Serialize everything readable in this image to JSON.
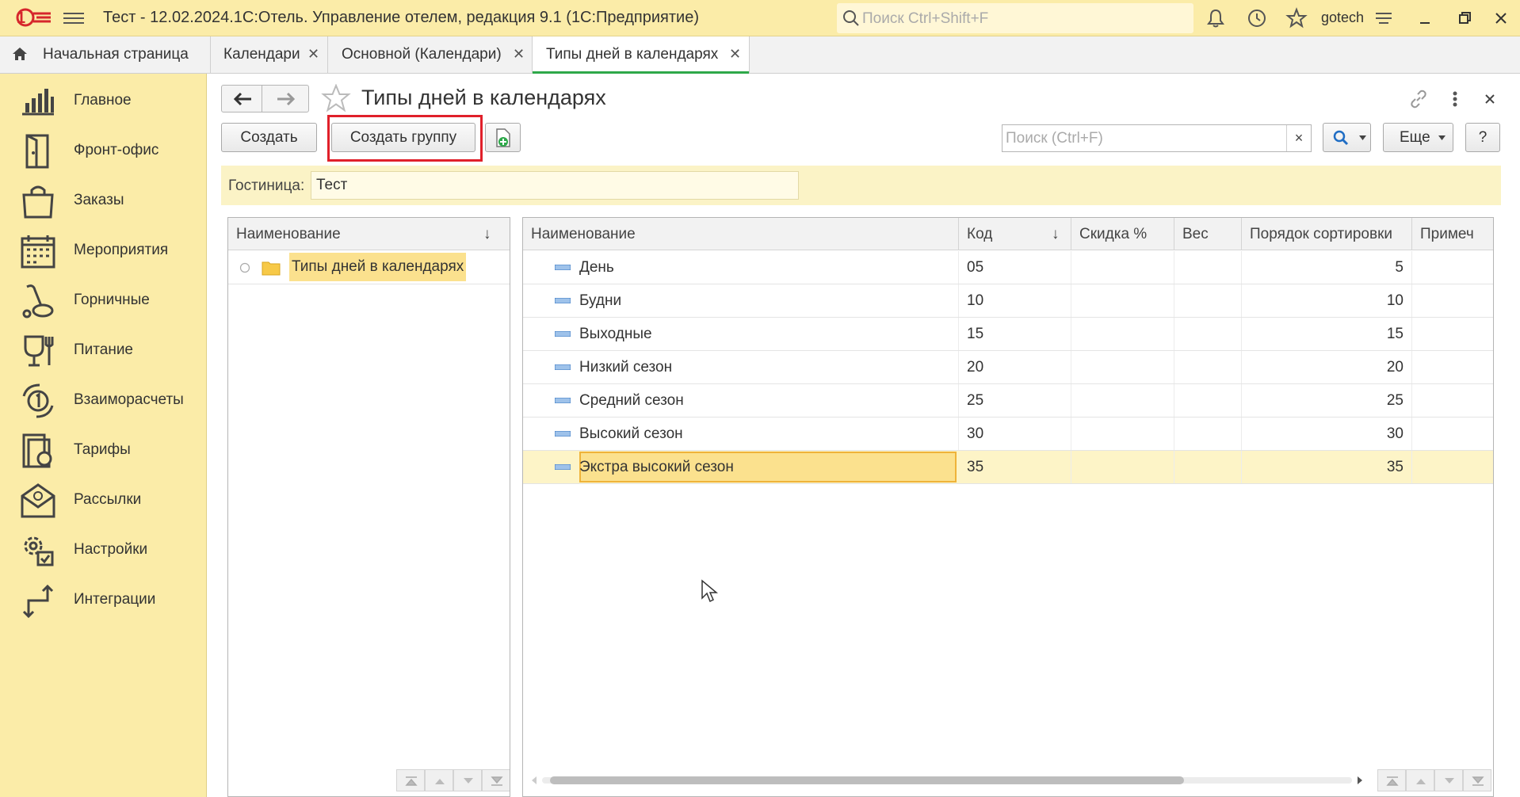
{
  "app": {
    "logo": "1С",
    "window_title": "Тест - 12.02.2024.1С:Отель. Управление отелем, редакция 9.1  (1С:Предприятие)",
    "search_placeholder": "Поиск Ctrl+Shift+F",
    "user": "gotech",
    "icons": [
      "menu-icon",
      "bell-icon",
      "history-icon",
      "star-icon",
      "settings-lines-icon",
      "minimize-icon",
      "restore-icon",
      "close-icon"
    ]
  },
  "tabs": [
    {
      "label": "Начальная страница",
      "icon": "home-icon",
      "closable": false,
      "active": false
    },
    {
      "label": "Календари",
      "closable": true,
      "active": false
    },
    {
      "label": "Основной (Календари)",
      "closable": true,
      "active": false
    },
    {
      "label": "Типы дней в календарях",
      "closable": true,
      "active": true
    }
  ],
  "sidebar": {
    "items": [
      {
        "label": "Главное",
        "icon": "chart-bars-icon"
      },
      {
        "label": "Фронт-офис",
        "icon": "door-icon"
      },
      {
        "label": "Заказы",
        "icon": "shopping-bag-icon"
      },
      {
        "label": "Мероприятия",
        "icon": "calendar-icon"
      },
      {
        "label": "Горничные",
        "icon": "vacuum-cleaner-icon"
      },
      {
        "label": "Питание",
        "icon": "cup-fork-icon"
      },
      {
        "label": "Взаиморасчеты",
        "icon": "coin-cycle-icon"
      },
      {
        "label": "Тарифы",
        "icon": "price-doc-icon"
      },
      {
        "label": "Рассылки",
        "icon": "mail-at-icon"
      },
      {
        "label": "Настройки",
        "icon": "gears-icon"
      },
      {
        "label": "Интеграции",
        "icon": "arrows-exchange-icon"
      }
    ]
  },
  "form": {
    "title": "Типы дней в календарях",
    "toolbar": {
      "create_label": "Создать",
      "create_group_label": "Создать группу",
      "search_placeholder": "Поиск (Ctrl+F)",
      "search_clear": "×",
      "more_label": "Еще",
      "help_label": "?"
    },
    "filter": {
      "label": "Гостиница:",
      "value": "Тест"
    }
  },
  "tree": {
    "header": "Наименование",
    "sort_arrow": "↓",
    "items": [
      {
        "label": "Типы дней в календарях",
        "icon": "folder-icon",
        "selected": true
      }
    ]
  },
  "list": {
    "columns": [
      "Наименование",
      "Код",
      "Скидка %",
      "Вес",
      "Порядок сортировки",
      "Примеч"
    ],
    "sort_arrow": "↓",
    "rows": [
      {
        "name": "День",
        "code": "05",
        "discount": "",
        "weight": "",
        "order": "5"
      },
      {
        "name": "Будни",
        "code": "10",
        "discount": "",
        "weight": "",
        "order": "10"
      },
      {
        "name": "Выходные",
        "code": "15",
        "discount": "",
        "weight": "",
        "order": "15"
      },
      {
        "name": "Низкий сезон",
        "code": "20",
        "discount": "",
        "weight": "",
        "order": "20"
      },
      {
        "name": "Средний сезон",
        "code": "25",
        "discount": "",
        "weight": "",
        "order": "25"
      },
      {
        "name": "Высокий сезон",
        "code": "30",
        "discount": "",
        "weight": "",
        "order": "30"
      },
      {
        "name": "Экстра высокий сезон",
        "code": "35",
        "discount": "",
        "weight": "",
        "order": "35"
      }
    ],
    "selected_row": 6,
    "colors": {
      "selected_row": "#fdf4c7",
      "focus_cell": "#fbe18e",
      "active_tab_bar": "#2ea84a",
      "sidebar": "#fbeca8",
      "highlight": "#e0202a"
    }
  }
}
